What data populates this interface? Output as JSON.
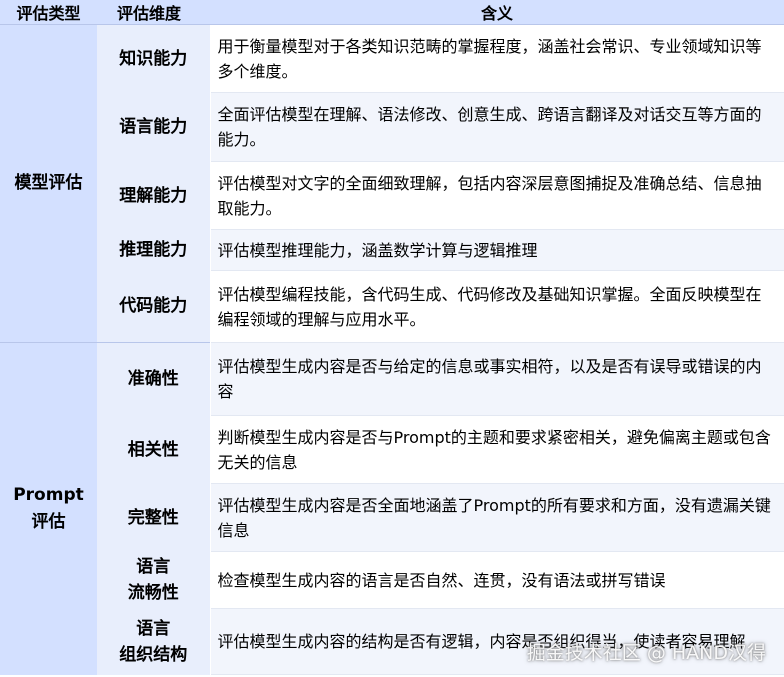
{
  "headers": {
    "type": "评估类型",
    "dimension": "评估维度",
    "meaning": "含义"
  },
  "groups": [
    {
      "type": "模型评估",
      "rows": [
        {
          "dimension": "知识能力",
          "meaning": "用于衡量模型对于各类知识范畴的掌握程度，涵盖社会常识、专业领域知识等多个维度。"
        },
        {
          "dimension": "语言能力",
          "meaning": "全面评估模型在理解、语法修改、创意生成、跨语言翻译及对话交互等方面的能力。"
        },
        {
          "dimension": "理解能力",
          "meaning": "评估模型对文字的全面细致理解，包括内容深层意图捕捉及准确总结、信息抽取能力。"
        },
        {
          "dimension": "推理能力",
          "meaning": "评估模型推理能力，涵盖数学计算与逻辑推理"
        },
        {
          "dimension": "代码能力",
          "meaning": "评估模型编程技能，含代码生成、代码修改及基础知识掌握。全面反映模型在编程领域的理解与应用水平。"
        }
      ]
    },
    {
      "type_line1": "Prompt",
      "type_line2": "评估",
      "rows": [
        {
          "dimension": "准确性",
          "meaning": "评估模型生成内容是否与给定的信息或事实相符，以及是否有误导或错误的内容"
        },
        {
          "dimension": "相关性",
          "meaning": "判断模型生成内容是否与Prompt的主题和要求紧密相关，避免偏离主题或包含无关的信息"
        },
        {
          "dimension": "完整性",
          "meaning": "评估模型生成内容是否全面地涵盖了Prompt的所有要求和方面，没有遗漏关键信息"
        },
        {
          "dimension_line1": "语言",
          "dimension_line2": "流畅性",
          "meaning": "检查模型生成内容的语言是否自然、连贯，没有语法或拼写错误"
        },
        {
          "dimension_line1": "语言",
          "dimension_line2": "组织结构",
          "meaning": "评估模型生成内容的结构是否有逻辑，内容是否组织得当，使读者容易理解"
        }
      ]
    }
  ],
  "watermark": "掘金技术社区 @ HAND汉得"
}
